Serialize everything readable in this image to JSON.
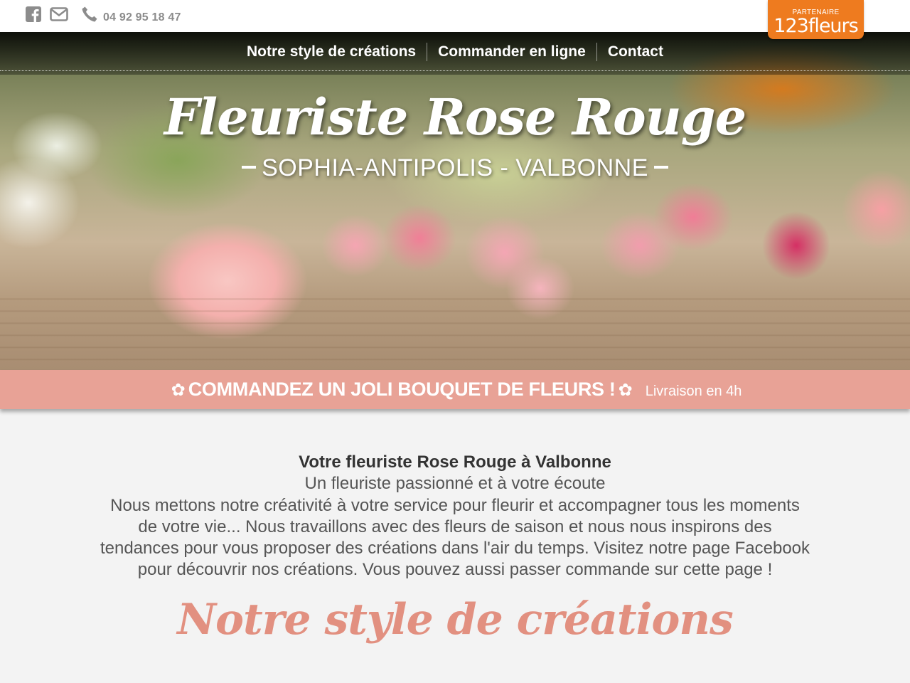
{
  "topbar": {
    "phone": "04 92 95 18 47"
  },
  "partner": {
    "label": "PARTENAIRE",
    "logo": "123fleurs"
  },
  "nav": {
    "items": [
      "Notre style de créations",
      "Commander en ligne",
      "Contact"
    ]
  },
  "hero": {
    "title": "Fleuriste Rose Rouge",
    "subtitle": "SOPHIA-ANTIPOLIS - VALBONNE"
  },
  "promo": {
    "main": "COMMANDEZ UN JOLI BOUQUET DE FLEURS !",
    "sub": "Livraison en 4h",
    "flower_glyph": "✿"
  },
  "content": {
    "title": "Votre fleuriste Rose Rouge à Valbonne",
    "subtitle": "Un fleuriste passionné et à votre écoute",
    "text": "Nous mettons notre créativité à votre service pour fleurir et accompagner tous les moments de votre vie... Nous travaillons avec des fleurs de saison et nous nous inspirons des tendances pour vous proposer des créations dans l'air du temps. Visitez notre page Facebook pour découvrir nos créations. Vous pouvez aussi passer commande sur cette page !",
    "section_heading": "Notre style de créations"
  },
  "colors": {
    "icon_grey": "#8c8c8c",
    "partner_orange": "#ee7b1f",
    "promo_pink": "#e8a296",
    "heading_pink": "#e29080"
  }
}
